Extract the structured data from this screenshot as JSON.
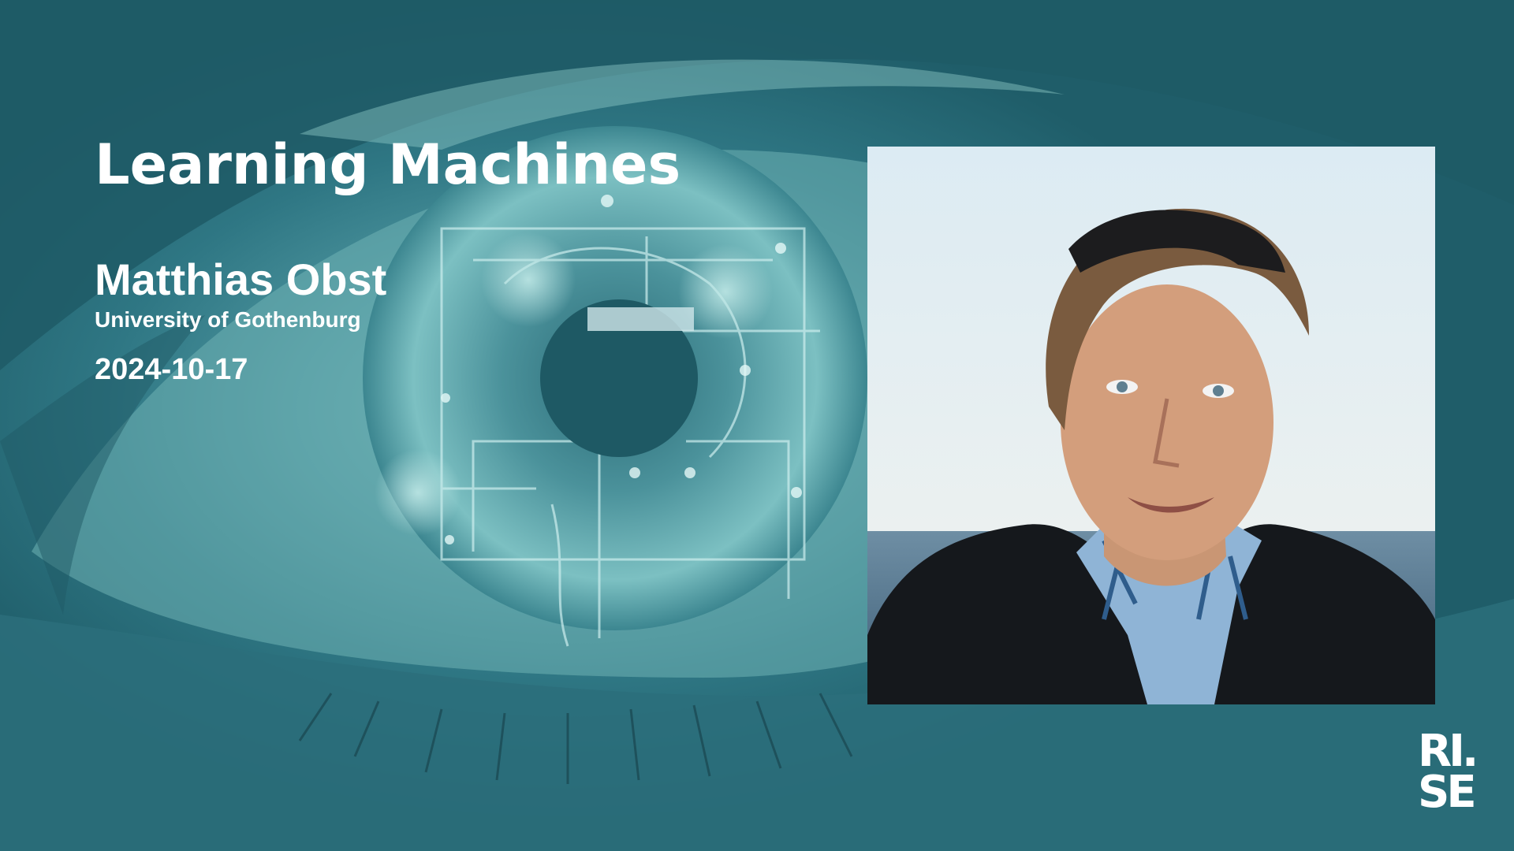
{
  "slide": {
    "title": "Learning Machines",
    "presenter": "Matthias Obst",
    "affiliation": "University of Gothenburg",
    "date": "2024-10-17"
  },
  "photo": {
    "subject": "presenter-portrait"
  },
  "logo": {
    "line1": "RI.",
    "line2": "SE"
  },
  "colors": {
    "background": "#2b6f7b",
    "text": "#ffffff"
  }
}
